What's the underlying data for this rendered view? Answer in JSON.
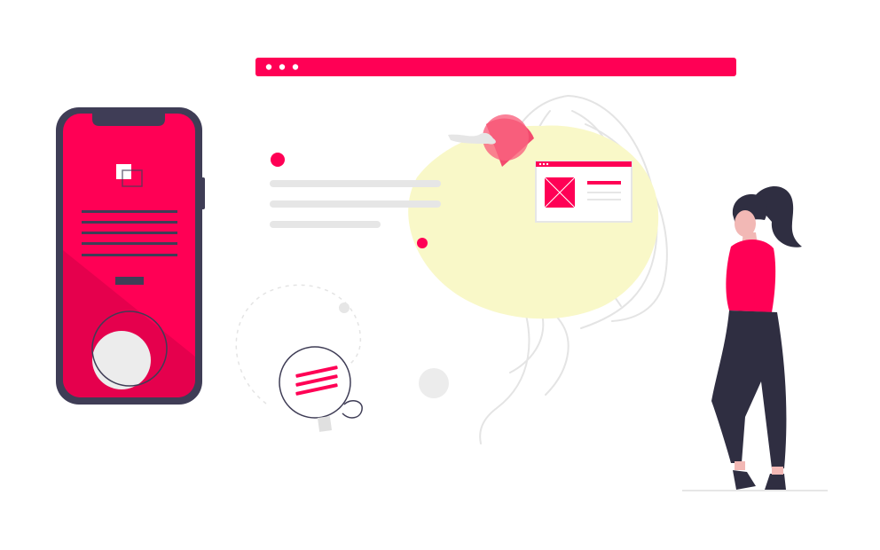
{
  "illustration": {
    "kind": "onboarding illustration",
    "colors": {
      "accent": "#ff0055",
      "accent_dark": "#e8004d",
      "device_frame": "#3f3d56",
      "dark_text": "#2f2e41",
      "blob": "#f9f8c8",
      "placeholder_line": "#e6e6e6",
      "line_art": "#e4e4e4",
      "light_circle": "#ececec"
    },
    "icons": {
      "browser_window": "browser-window-icon",
      "phone": "smartphone-icon",
      "bird": "bird-icon",
      "chat_bubble": "chat-bubble-icon",
      "woman": "person-icon"
    }
  }
}
